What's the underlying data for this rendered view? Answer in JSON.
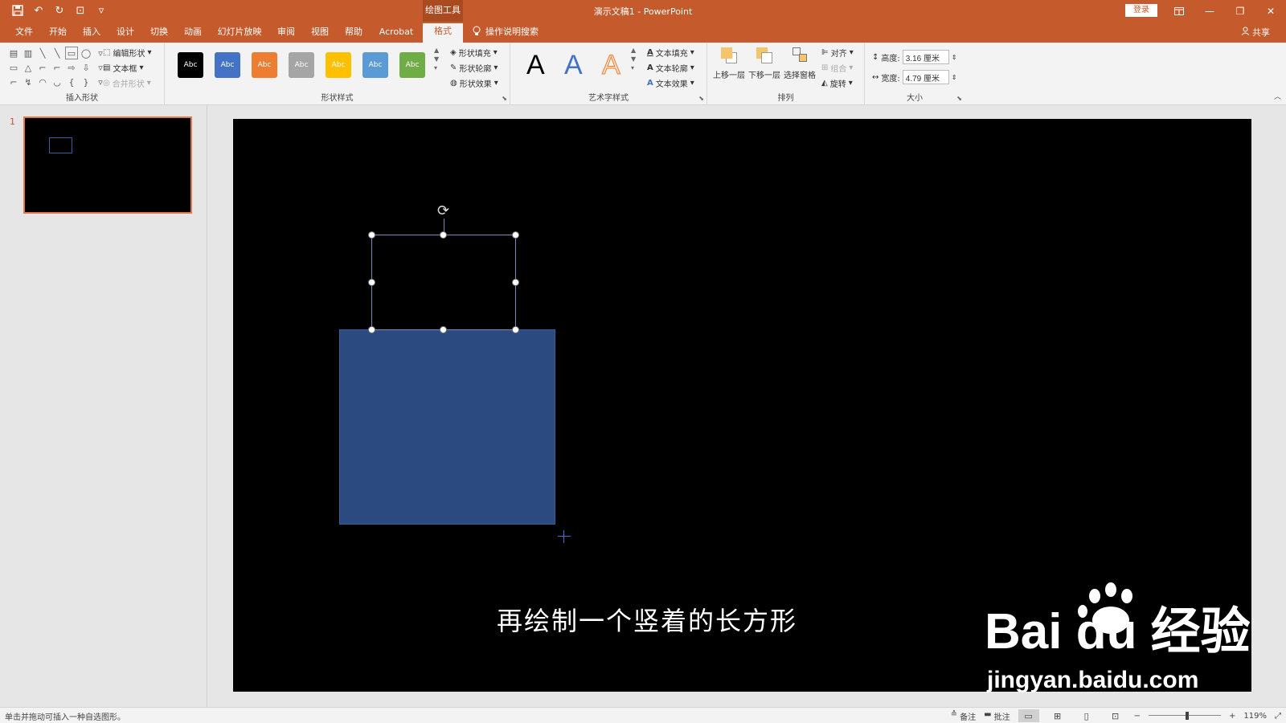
{
  "titlebar": {
    "title": "演示文稿1  -  PowerPoint",
    "context_tab": "绘图工具",
    "login": "登录",
    "qat": {
      "save": "💾",
      "undo": "↶",
      "redo": "↻",
      "present": "⊡",
      "customize": "▿"
    }
  },
  "tabs": [
    {
      "label": "文件"
    },
    {
      "label": "开始"
    },
    {
      "label": "插入"
    },
    {
      "label": "设计"
    },
    {
      "label": "切换"
    },
    {
      "label": "动画"
    },
    {
      "label": "幻灯片放映"
    },
    {
      "label": "审阅"
    },
    {
      "label": "视图"
    },
    {
      "label": "帮助"
    },
    {
      "label": "Acrobat"
    },
    {
      "label": "格式",
      "active": true
    }
  ],
  "tell_me": "操作说明搜索",
  "share": "共享",
  "ribbon": {
    "insert_shapes": {
      "label": "插入形状",
      "edit_shape": "编辑形状",
      "text_box": "文本框",
      "merge_shapes": "合并形状",
      "shapes": [
        "▤",
        "▥",
        "╲",
        "╲",
        "▭",
        "◯",
        "▿",
        "▭",
        "△",
        "⌐",
        "⌐",
        "⇨",
        "⇩",
        "▿",
        "⌐",
        "↯",
        "◠",
        "◡",
        "{",
        "}",
        "▿"
      ]
    },
    "shape_styles": {
      "label": "形状样式",
      "swatches": [
        {
          "text": "Abc",
          "color": "#000000"
        },
        {
          "text": "Abc",
          "color": "#4472c4"
        },
        {
          "text": "Abc",
          "color": "#ed7d31"
        },
        {
          "text": "Abc",
          "color": "#a5a5a5"
        },
        {
          "text": "Abc",
          "color": "#ffc000"
        },
        {
          "text": "Abc",
          "color": "#5b9bd5"
        },
        {
          "text": "Abc",
          "color": "#70ad47"
        }
      ],
      "fill": "形状填充",
      "outline": "形状轮廓",
      "effects": "形状效果"
    },
    "wordart": {
      "label": "艺术字样式",
      "samples": [
        "A",
        "A",
        "A"
      ],
      "text_fill": "文本填充",
      "text_outline": "文本轮廓",
      "text_effects": "文本效果"
    },
    "arrange": {
      "label": "排列",
      "bring_forward": "上移一层",
      "send_backward": "下移一层",
      "selection_pane": "选择窗格",
      "align": "对齐",
      "group": "组合",
      "rotate": "旋转"
    },
    "size": {
      "label": "大小",
      "height_label": "高度:",
      "height_value": "3.16 厘米",
      "width_label": "宽度:",
      "width_value": "4.79 厘米"
    }
  },
  "slides": [
    {
      "number": "1"
    }
  ],
  "slide": {
    "caption": "再绘制一个竖着的长方形",
    "rect_color": "#2a4a80",
    "background": "#000000"
  },
  "watermark": {
    "logo_text": "Bai du 经验",
    "url": "jingyan.baidu.com"
  },
  "status": {
    "hint": "单击并拖动可插入一种自选图形。",
    "notes": "备注",
    "comments": "批注",
    "zoom_percent": "119%",
    "zoom_level": 119,
    "zoom_minus": "−",
    "zoom_plus": "+"
  },
  "colors": {
    "accent": "#c55a2c",
    "ribbon_bg": "#f3f3f3"
  }
}
